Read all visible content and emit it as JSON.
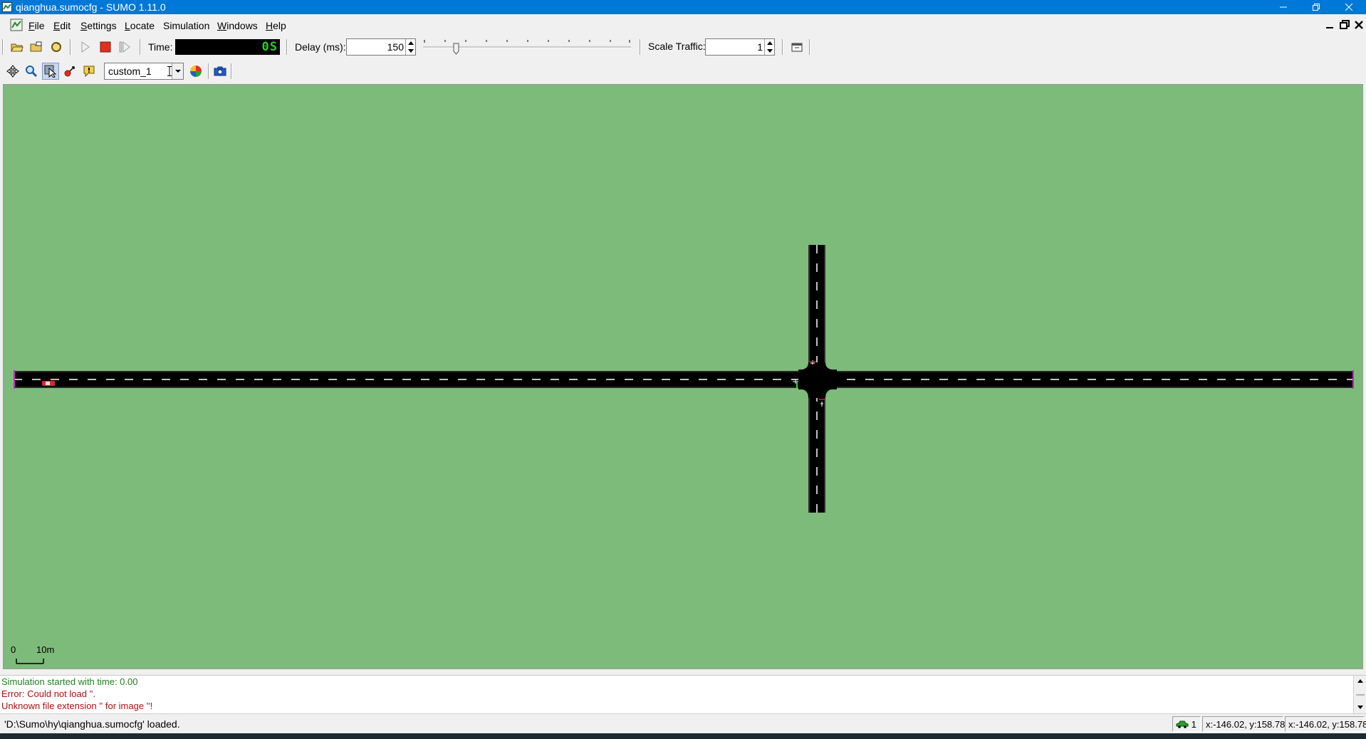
{
  "window": {
    "title": "qianghua.sumocfg - SUMO 1.11.0"
  },
  "menu": [
    {
      "label": "File",
      "mnemonic": "F",
      "rest": "ile"
    },
    {
      "label": "Edit",
      "mnemonic": "E",
      "rest": "dit"
    },
    {
      "label": "Settings",
      "mnemonic": "S",
      "rest": "ettings"
    },
    {
      "label": "Locate",
      "mnemonic": "L",
      "rest": "ocate"
    },
    {
      "label": "Simulation",
      "mnemonic": "",
      "rest": "Simulation"
    },
    {
      "label": "Windows",
      "mnemonic": "W",
      "rest": "indows"
    },
    {
      "label": "Help",
      "mnemonic": "H",
      "rest": "elp"
    }
  ],
  "toolbar": {
    "time_label": "Time:",
    "time_value": "0S",
    "delay_label": "Delay (ms):",
    "delay_value": "150",
    "scale_label": "Scale Traffic:",
    "scale_value": "1"
  },
  "view_toolbar": {
    "scheme_value": "custom_1"
  },
  "canvas": {
    "scale_zero": "0",
    "scale_label": "10m",
    "background": "#7dbb7a",
    "road_color": "#000000"
  },
  "messages": [
    {
      "text": "Simulation started with time: 0.00",
      "color": "#1f7f1f"
    },
    {
      "text": "Error: Could not load ''.",
      "color": "#aa1111"
    },
    {
      "text": "Unknown file extension '' for image ''!",
      "color": "#aa1111"
    }
  ],
  "statusbar": {
    "message": "'D:\\Sumo\\hy\\qianghua.sumocfg' loaded.",
    "vehicle_count": "1",
    "coord1": "x:-146.02, y:158.78",
    "coord2": "x:-146.02, y:158.78"
  }
}
